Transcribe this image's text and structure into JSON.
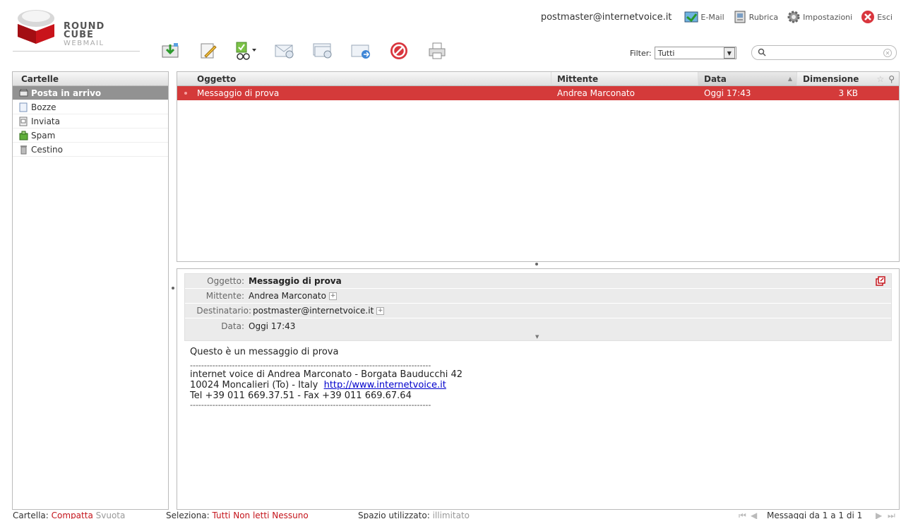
{
  "logo": {
    "line1": "ROUND",
    "line2": "CUBE",
    "line3": "WEBMAIL"
  },
  "user": "postmaster@internetvoice.it",
  "topnav": [
    {
      "label": "E-Mail",
      "icon": "mail-icon"
    },
    {
      "label": "Rubrica",
      "icon": "addressbook-icon"
    },
    {
      "label": "Impostazioni",
      "icon": "gear-icon"
    },
    {
      "label": "Esci",
      "icon": "logout-icon"
    }
  ],
  "filter": {
    "label": "Filter:",
    "value": "Tutti"
  },
  "search": {
    "placeholder": ""
  },
  "folders": {
    "title": "Cartelle",
    "items": [
      {
        "label": "Posta in arrivo",
        "icon": "inbox-icon",
        "selected": true
      },
      {
        "label": "Bozze",
        "icon": "drafts-icon"
      },
      {
        "label": "Inviata",
        "icon": "sent-icon"
      },
      {
        "label": "Spam",
        "icon": "spam-icon"
      },
      {
        "label": "Cestino",
        "icon": "trash-icon"
      }
    ]
  },
  "messagelist": {
    "columns": {
      "subject": "Oggetto",
      "from": "Mittente",
      "date": "Data",
      "size": "Dimensione"
    },
    "rows": [
      {
        "subject": "Messaggio di prova",
        "from": "Andrea Marconato",
        "date": "Oggi 17:43",
        "size": "3 KB"
      }
    ]
  },
  "preview": {
    "labels": {
      "subject": "Oggetto:",
      "from": "Mittente:",
      "to": "Destinatario:",
      "date": "Data:"
    },
    "subject": "Messaggio di prova",
    "from": "Andrea Marconato",
    "to": "postmaster@internetvoice.it",
    "date": "Oggi 17:43",
    "body_greeting": "Questo è un messaggio di prova",
    "separator": "--------------------------------------------------------------------------------------",
    "sig1": "internet voice di Andrea Marconato - Borgata Bauducchi 42",
    "sig2": "10024 Moncalieri (To) - Italy",
    "link": "http://www.internetvoice.it",
    "sig3": "Tel +39 011 669.37.51 - Fax +39 011 669.67.64"
  },
  "footer": {
    "folder_label": "Cartella:",
    "compact": "Compatta",
    "empty": "Svuota",
    "select_label": "Seleziona:",
    "all": "Tutti",
    "unread": "Non letti",
    "none": "Nessuno",
    "quota_label": "Spazio utilizzato:",
    "quota_value": "illimitato",
    "count": "Messaggi da 1 a 1 di 1"
  },
  "colors": {
    "accent": "#d43a3a",
    "selected_folder": "#929292",
    "link_red": "#c4141b"
  }
}
